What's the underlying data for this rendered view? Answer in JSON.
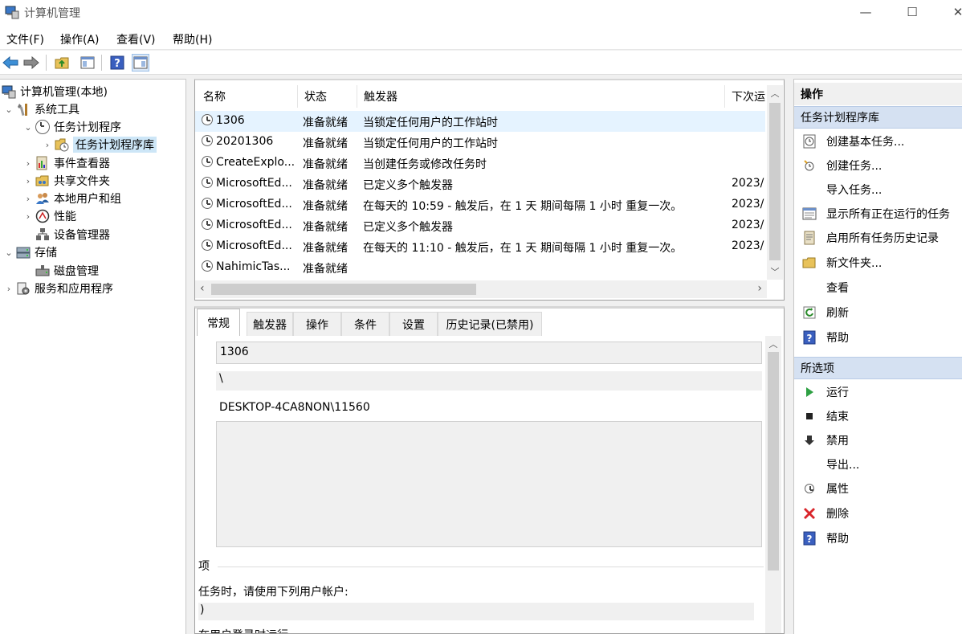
{
  "window": {
    "title": "计算机管理",
    "controls": {
      "minimize": "—",
      "maximize": "☐",
      "close": "✕"
    }
  },
  "menu": [
    "文件(F)",
    "操作(A)",
    "查看(V)",
    "帮助(H)"
  ],
  "toolbar": {
    "buttons": [
      "back-arrow-icon",
      "forward-arrow-icon",
      "up-folder-icon",
      "show-hide-tree-icon",
      "help-icon",
      "show-hide-action-pane-icon"
    ]
  },
  "tree": {
    "items": [
      {
        "label": "计算机管理(本地)",
        "icon": "computer-management-icon",
        "expander": ""
      },
      {
        "label": "系统工具",
        "icon": "tools-icon",
        "expander": "⌄"
      },
      {
        "label": "任务计划程序",
        "icon": "clock-icon",
        "expander": "⌄"
      },
      {
        "label": "任务计划程序库",
        "icon": "folder-clock-icon",
        "expander": "›"
      },
      {
        "label": "事件查看器",
        "icon": "event-viewer-icon",
        "expander": "›"
      },
      {
        "label": "共享文件夹",
        "icon": "shared-folder-icon",
        "expander": "›"
      },
      {
        "label": "本地用户和组",
        "icon": "users-icon",
        "expander": "›"
      },
      {
        "label": "性能",
        "icon": "performance-icon",
        "expander": "›"
      },
      {
        "label": "设备管理器",
        "icon": "device-manager-icon",
        "expander": ""
      },
      {
        "label": "存储",
        "icon": "storage-icon",
        "expander": "⌄"
      },
      {
        "label": "磁盘管理",
        "icon": "disk-icon",
        "expander": ""
      },
      {
        "label": "服务和应用程序",
        "icon": "services-icon",
        "expander": "›"
      }
    ]
  },
  "task_list": {
    "columns": [
      "名称",
      "状态",
      "触发器",
      "下次运"
    ],
    "rows": [
      {
        "name": "1306",
        "status": "准备就绪",
        "trigger": "当锁定任何用户的工作站时",
        "next": ""
      },
      {
        "name": "20201306",
        "status": "准备就绪",
        "trigger": "当锁定任何用户的工作站时",
        "next": ""
      },
      {
        "name": "CreateExplo...",
        "status": "准备就绪",
        "trigger": "当创建任务或修改任务时",
        "next": ""
      },
      {
        "name": "MicrosoftEd...",
        "status": "准备就绪",
        "trigger": "已定义多个触发器",
        "next": "2023/"
      },
      {
        "name": "MicrosoftEd...",
        "status": "准备就绪",
        "trigger": "在每天的 10:59 - 触发后，在 1 天 期间每隔 1 小时 重复一次。",
        "next": "2023/"
      },
      {
        "name": "MicrosoftEd...",
        "status": "准备就绪",
        "trigger": "已定义多个触发器",
        "next": "2023/"
      },
      {
        "name": "MicrosoftEd...",
        "status": "准备就绪",
        "trigger": "在每天的 11:10 - 触发后，在 1 天 期间每隔 1 小时 重复一次。",
        "next": "2023/"
      },
      {
        "name": "NahimicTas...",
        "status": "准备就绪",
        "trigger": "",
        "next": ""
      }
    ]
  },
  "detail": {
    "tabs": [
      "常规",
      "触发器",
      "操作",
      "条件",
      "设置",
      "历史记录(已禁用)"
    ],
    "name_value": "1306",
    "location_value": "\\",
    "author_value": "DESKTOP-4CA8NON\\11560",
    "security_label_partial": "项",
    "run_as_label_partial": "任务时，请使用下列用户帐户:",
    "user_value_partial": ")",
    "run_when_partial": "在用户登录时运行"
  },
  "actions": {
    "header": "操作",
    "section1": "任务计划程序库",
    "items1": [
      {
        "label": "创建基本任务...",
        "icon": "create-basic-task-icon"
      },
      {
        "label": "创建任务...",
        "icon": "create-task-icon"
      },
      {
        "label": "导入任务...",
        "icon": ""
      },
      {
        "label": "显示所有正在运行的任务",
        "icon": "running-tasks-icon"
      },
      {
        "label": "启用所有任务历史记录",
        "icon": "history-icon"
      },
      {
        "label": "新文件夹...",
        "icon": "new-folder-icon"
      },
      {
        "label": "查看",
        "icon": ""
      },
      {
        "label": "刷新",
        "icon": "refresh-icon"
      },
      {
        "label": "帮助",
        "icon": "help-icon"
      }
    ],
    "section2": "所选项",
    "items2": [
      {
        "label": "运行",
        "icon": "run-icon"
      },
      {
        "label": "结束",
        "icon": "end-icon"
      },
      {
        "label": "禁用",
        "icon": "disable-icon"
      },
      {
        "label": "导出...",
        "icon": ""
      },
      {
        "label": "属性",
        "icon": "properties-icon"
      },
      {
        "label": "删除",
        "icon": "delete-icon"
      },
      {
        "label": "帮助",
        "icon": "help-icon"
      }
    ]
  },
  "colors": {
    "selection": "#cde6f7",
    "section_header": "#d5e1f2",
    "help_blue": "#3a5fbf",
    "run_green": "#2ea043",
    "delete_red": "#d9252b"
  }
}
